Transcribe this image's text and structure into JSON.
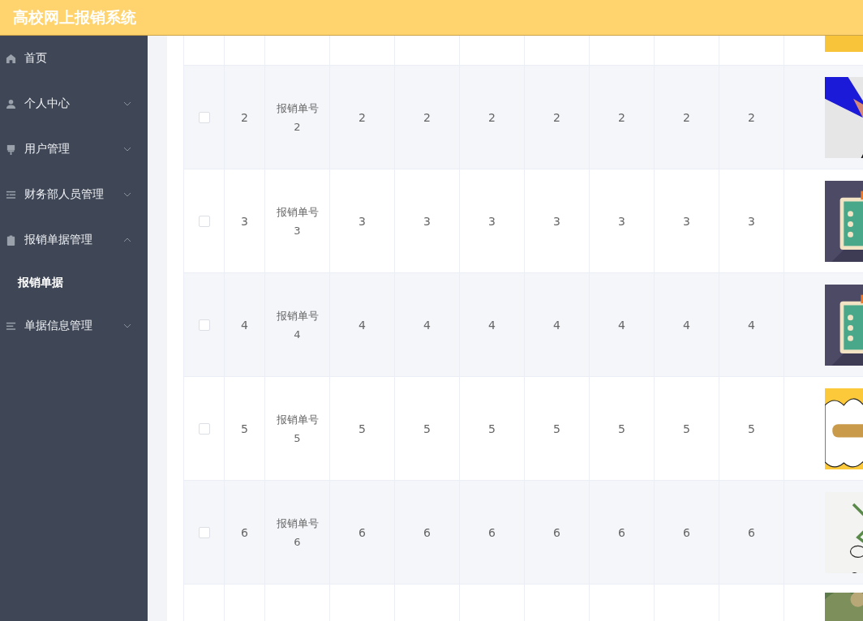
{
  "header": {
    "title": "高校网上报销系统"
  },
  "sidebar": {
    "items": [
      {
        "label": "首页"
      },
      {
        "label": "个人中心",
        "expanded": false
      },
      {
        "label": "用户管理",
        "expanded": false
      },
      {
        "label": "财务部人员管理",
        "expanded": false
      },
      {
        "label": "报销单据管理",
        "expanded": true,
        "children": [
          {
            "label": "报销单据",
            "selected": true
          }
        ]
      },
      {
        "label": "单据信息管理",
        "expanded": false
      }
    ]
  },
  "table": {
    "rows": [
      {
        "kind": "cut"
      },
      {
        "kind": "data",
        "checked": false,
        "index": "2",
        "name": [
          "报销单号",
          "2"
        ],
        "values": [
          "2",
          "2",
          "2",
          "2",
          "2",
          "2",
          "2"
        ]
      },
      {
        "kind": "data",
        "checked": false,
        "index": "3",
        "name": [
          "报销单号",
          "3"
        ],
        "values": [
          "3",
          "3",
          "3",
          "3",
          "3",
          "3",
          "3"
        ]
      },
      {
        "kind": "data",
        "checked": false,
        "index": "4",
        "name": [
          "报销单号",
          "4"
        ],
        "values": [
          "4",
          "4",
          "4",
          "4",
          "4",
          "4",
          "4"
        ]
      },
      {
        "kind": "data",
        "checked": false,
        "index": "5",
        "name": [
          "报销单号",
          "5"
        ],
        "values": [
          "5",
          "5",
          "5",
          "5",
          "5",
          "5",
          "5"
        ]
      },
      {
        "kind": "data",
        "checked": false,
        "index": "6",
        "name": [
          "报销单号",
          "6"
        ],
        "values": [
          "6",
          "6",
          "6",
          "6",
          "6",
          "6",
          "6"
        ]
      },
      {
        "kind": "cut"
      }
    ]
  }
}
